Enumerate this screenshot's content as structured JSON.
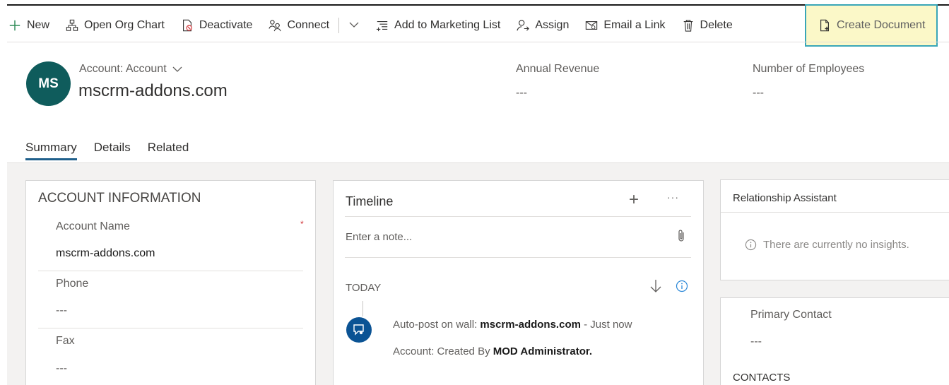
{
  "toolbar": {
    "new_label": "New",
    "org_chart_label": "Open Org Chart",
    "deactivate_label": "Deactivate",
    "connect_label": "Connect",
    "add_marketing_label": "Add to Marketing List",
    "assign_label": "Assign",
    "email_link_label": "Email a Link",
    "delete_label": "Delete",
    "create_document_label": "Create Document"
  },
  "header": {
    "avatar_initials": "MS",
    "entity_type": "Account: Account",
    "entity_name": "mscrm-addons.com",
    "fields": [
      {
        "label": "Annual Revenue",
        "value": "---"
      },
      {
        "label": "Number of Employees",
        "value": "---"
      }
    ]
  },
  "tabs": [
    {
      "label": "Summary",
      "active": true
    },
    {
      "label": "Details",
      "active": false
    },
    {
      "label": "Related",
      "active": false
    }
  ],
  "account_info": {
    "title": "ACCOUNT INFORMATION",
    "required_mark": "*",
    "fields": [
      {
        "label": "Account Name",
        "value": "mscrm-addons.com"
      },
      {
        "label": "Phone",
        "value": "---"
      },
      {
        "label": "Fax",
        "value": "---"
      }
    ]
  },
  "timeline": {
    "title": "Timeline",
    "add_symbol": "+",
    "more_symbol": "···",
    "note_placeholder": "Enter a note...",
    "today_label": "TODAY",
    "post_prefix": "Auto-post on wall:",
    "post_entity": "mscrm-addons.com",
    "post_time": "- Just now",
    "post_sub_prefix": "Account: Created By",
    "post_sub_user": "MOD Administrator."
  },
  "relationship_assistant": {
    "title": "Relationship Assistant",
    "message": "There are currently no insights."
  },
  "primary_contact": {
    "label": "Primary Contact",
    "value": "---",
    "contacts_title": "CONTACTS"
  },
  "colors": {
    "avatar": "#0f5c5c",
    "accent": "#1f5f8b",
    "highlight_bg": "#fbf8c8",
    "highlight_border": "#39a6b8",
    "timeline_avatar": "#0b5394"
  }
}
